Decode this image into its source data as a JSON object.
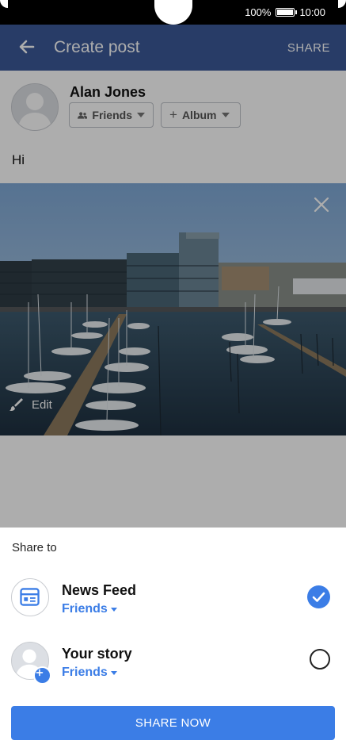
{
  "status": {
    "battery": "100%",
    "time": "10:00"
  },
  "appbar": {
    "title": "Create post",
    "share_label": "SHARE"
  },
  "author": {
    "name": "Alan Jones"
  },
  "audience": {
    "friends_label": "Friends",
    "album_label": "Album"
  },
  "post": {
    "text": "Hi",
    "edit_label": "Edit"
  },
  "sheet": {
    "heading": "Share to",
    "options": [
      {
        "title": "News Feed",
        "audience": "Friends",
        "selected": true
      },
      {
        "title": "Your story",
        "audience": "Friends",
        "selected": false
      }
    ],
    "share_now_label": "SHARE NOW"
  },
  "colors": {
    "brand": "#3b5998",
    "accent": "#3b7de6"
  }
}
